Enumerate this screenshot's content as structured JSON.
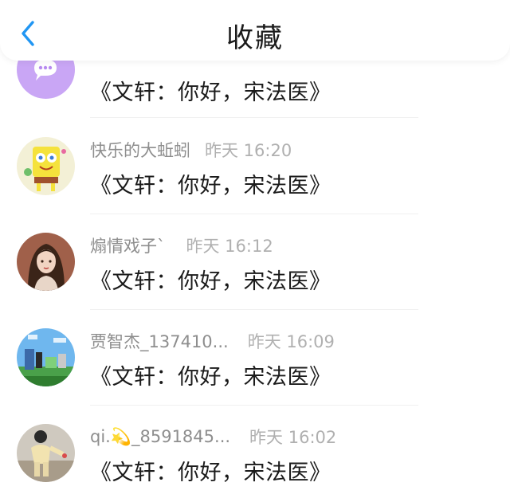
{
  "header": {
    "title": "收藏",
    "back_icon": "chevron-left-icon",
    "accent_color": "#2196f3"
  },
  "items": [
    {
      "name": "",
      "time": "",
      "message": "《文轩：你好，宋法医》",
      "avatar": "purple-chat-bubble-avatar"
    },
    {
      "name": "快乐的大蚯蚓",
      "time": "昨天 16:20",
      "message": "《文轩：你好，宋法医》",
      "avatar": "cartoon-sponge-avatar"
    },
    {
      "name": "煽情戏子`",
      "time": "昨天 16:12",
      "message": "《文轩：你好，宋法医》",
      "avatar": "girl-portrait-avatar"
    },
    {
      "name": "贾智杰_137410...",
      "time": "昨天 16:09",
      "message": "《文轩：你好，宋法医》",
      "avatar": "blocky-game-avatar"
    },
    {
      "name": "qi.💫_8591845...",
      "time": "昨天 16:02",
      "message": "《文轩：你好，宋法医》",
      "avatar": "person-photo-avatar"
    }
  ]
}
